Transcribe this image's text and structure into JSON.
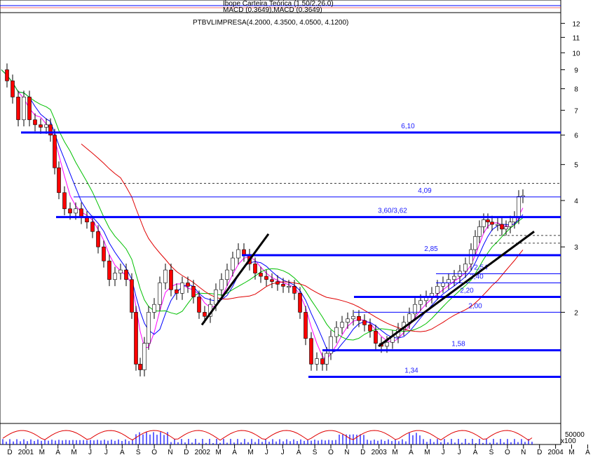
{
  "top_panel": {
    "line1": "Ibope Carteira Teórica (1.50/2.26.0)",
    "line2": "MACD (0.3649),MACD (0.3649)"
  },
  "price_panel": {
    "title": "PTBVLIMPRESA(4.2000, 4.3500, 4.0500, 4.1200)"
  },
  "bottom_panel": {
    "y_tick": "50000",
    "multiplier": "x100"
  },
  "colors": {
    "support_lines": "#0000ff",
    "ma_fast_blue": "#0000ff",
    "ma_magenta": "#ff00ff",
    "ma_green": "#00c000",
    "ma_red": "#e00000",
    "up_candle": "#ffffff",
    "down_candle": "#ff0000",
    "trendlines": "#000000"
  },
  "chart_data": {
    "type": "candlestick",
    "y_scale": "log",
    "y_ticks": [
      2,
      3,
      4,
      5,
      6,
      7,
      8,
      9,
      10,
      11,
      12
    ],
    "x_ticks": [
      "D",
      "2001",
      "M",
      "A",
      "M",
      "J",
      "J",
      "A",
      "S",
      "O",
      "N",
      "D",
      "2002",
      "M",
      "A",
      "M",
      "J",
      "J",
      "A",
      "S",
      "O",
      "N",
      "D",
      "2003",
      "M",
      "A",
      "M",
      "J",
      "J",
      "A",
      "S",
      "O",
      "N",
      "D",
      "2004",
      "M",
      "A"
    ],
    "levels": [
      {
        "label": "6,10",
        "value": 6.1
      },
      {
        "label": "4,09",
        "value": 4.09
      },
      {
        "label": "3,60/3,62",
        "value": 3.61
      },
      {
        "label": "2,85",
        "value": 2.85
      },
      {
        "label": "2,54",
        "value": 2.54
      },
      {
        "label": "2,40",
        "value": 2.4
      },
      {
        "label": "2,20",
        "value": 2.2
      },
      {
        "label": "2,00",
        "value": 2.0
      },
      {
        "label": "1,58",
        "value": 1.58
      },
      {
        "label": "1,34",
        "value": 1.34
      }
    ]
  }
}
